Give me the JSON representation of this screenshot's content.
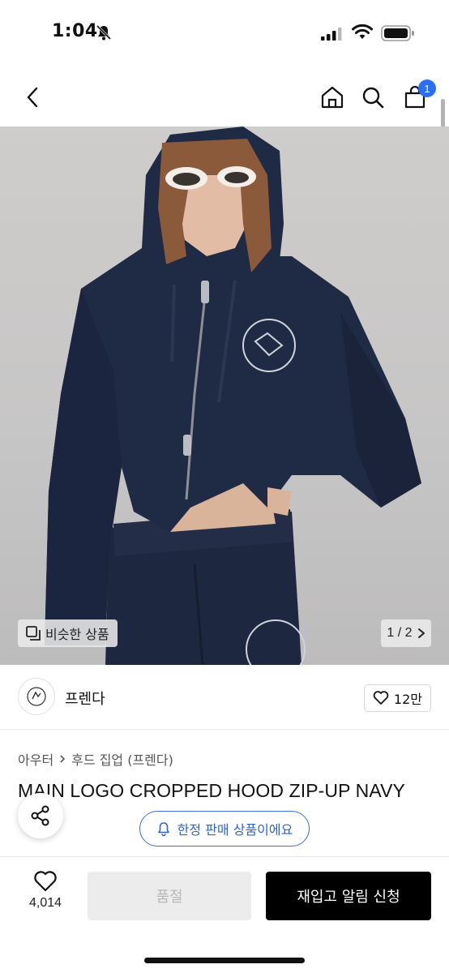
{
  "status_bar": {
    "time": "1:04"
  },
  "nav": {
    "cart_count": "1"
  },
  "hero": {
    "similar_label": "비슷한 상품",
    "page_indicator": "1 / 2",
    "image_count": 2,
    "current_image": 1
  },
  "brand": {
    "name": "프렌다",
    "like_count": "12만"
  },
  "breadcrumb": {
    "category": "아우터",
    "subcategory": "후드 집업 (프렌다)"
  },
  "product": {
    "title": "MAIN LOGO CROPPED HOOD ZIP-UP NAVY"
  },
  "limited_banner": {
    "label": "한정 판매 상품이에요"
  },
  "bottom_bar": {
    "wish_count": "4,014",
    "soldout_label": "품절",
    "restock_label": "재입고 알림 신청"
  },
  "colors": {
    "accent_blue": "#2b6ff2",
    "primary_black": "#000000",
    "disabled_gray": "#ececec",
    "hoodie_navy": "#1f2a44"
  }
}
